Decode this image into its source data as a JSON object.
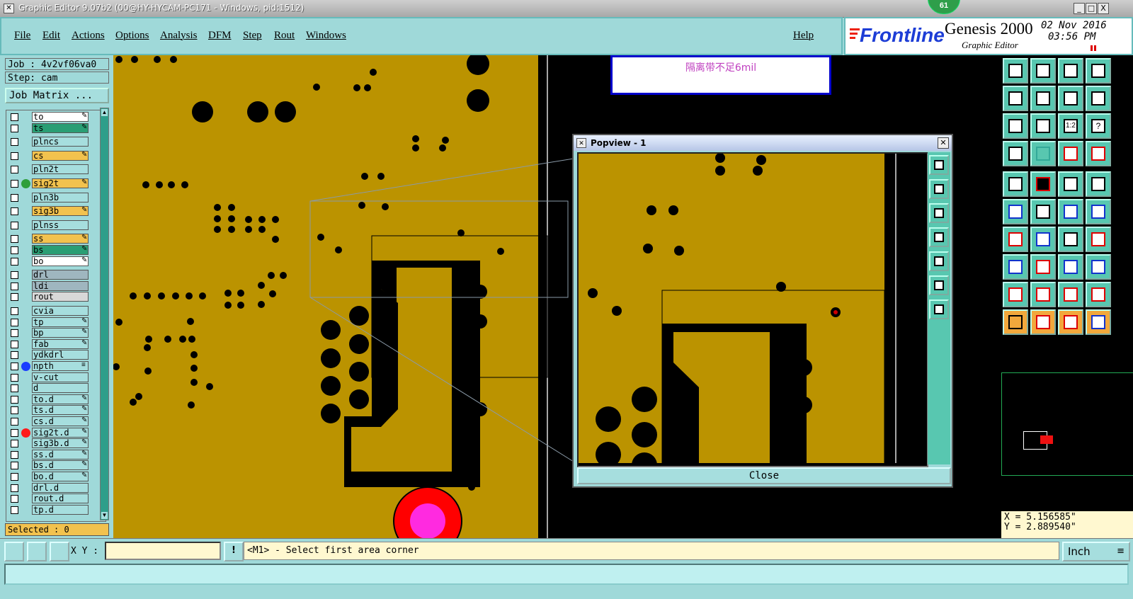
{
  "window": {
    "title": "Graphic Editor 9.07b2 (00@HY-HYCAM-PC171 - Windows, pid:1512)",
    "badge": "61",
    "minimize": "_",
    "maximize": "□",
    "close": "X"
  },
  "menu": {
    "items": [
      "File",
      "Edit",
      "Actions",
      "Options",
      "Analysis",
      "DFM",
      "Step",
      "Rout",
      "Windows"
    ],
    "help": "Help"
  },
  "brand": {
    "logo": "Frontline",
    "product": "Genesis 2000",
    "subtitle": "Graphic Editor",
    "date": "02 Nov 2016",
    "time": "03:56 PM"
  },
  "job": {
    "job_label": "Job : 4v2vf06va0",
    "step_label": "Step: cam",
    "matrix_button": "Job Matrix ..."
  },
  "layers": [
    {
      "name": "to",
      "color": "#ffffff",
      "mark": "✎"
    },
    {
      "name": "ts",
      "color": "#2a9e74",
      "mark": "✎"
    },
    {
      "name": "plncs",
      "color": "#a6dede",
      "mark": ""
    },
    {
      "name": "cs",
      "color": "#f2c24e",
      "mark": "✎"
    },
    {
      "name": "pln2t",
      "color": "#a6dede",
      "mark": ""
    },
    {
      "name": "sig2t",
      "color": "#f2c24e",
      "mark": "✎",
      "dot": "#2e9e3a"
    },
    {
      "name": "pln3b",
      "color": "#a6dede",
      "mark": ""
    },
    {
      "name": "sig3b",
      "color": "#f2c24e",
      "mark": "✎"
    },
    {
      "name": "plnss",
      "color": "#a6dede",
      "mark": ""
    },
    {
      "name": "ss",
      "color": "#f2c24e",
      "mark": "✎"
    },
    {
      "name": "bs",
      "color": "#2a9e74",
      "mark": "✎"
    },
    {
      "name": "bo",
      "color": "#ffffff",
      "mark": "✎"
    },
    {
      "name": "drl",
      "color": "#9fb6bf",
      "mark": ""
    },
    {
      "name": "ldi",
      "color": "#9fb6bf",
      "mark": ""
    },
    {
      "name": "rout",
      "color": "#d8d8d8",
      "mark": ""
    },
    {
      "name": "cvia",
      "color": "#a6dede",
      "mark": ""
    },
    {
      "name": "tp",
      "color": "#a6dede",
      "mark": "✎"
    },
    {
      "name": "bp",
      "color": "#a6dede",
      "mark": "✎"
    },
    {
      "name": "fab",
      "color": "#a6dede",
      "mark": "✎"
    },
    {
      "name": "ydkdrl",
      "color": "#a6dede",
      "mark": ""
    },
    {
      "name": "npth",
      "color": "#a6dede",
      "mark": "≡",
      "dot": "#1a3cff"
    },
    {
      "name": "v-cut",
      "color": "#a6dede",
      "mark": ""
    },
    {
      "name": "d",
      "color": "#a6dede",
      "mark": ""
    },
    {
      "name": "to.d",
      "color": "#a6dede",
      "mark": "✎"
    },
    {
      "name": "ts.d",
      "color": "#a6dede",
      "mark": "✎"
    },
    {
      "name": "cs.d",
      "color": "#a6dede",
      "mark": "✎"
    },
    {
      "name": "sig2t.d",
      "color": "#a6dede",
      "mark": "✎",
      "dot": "#ff1a1a"
    },
    {
      "name": "sig3b.d",
      "color": "#a6dede",
      "mark": "✎"
    },
    {
      "name": "ss.d",
      "color": "#a6dede",
      "mark": "✎"
    },
    {
      "name": "bs.d",
      "color": "#a6dede",
      "mark": "✎"
    },
    {
      "name": "bo.d",
      "color": "#a6dede",
      "mark": "✎"
    },
    {
      "name": "drl.d",
      "color": "#a6dede",
      "mark": ""
    },
    {
      "name": "rout.d",
      "color": "#a6dede",
      "mark": ""
    },
    {
      "name": "tp.d",
      "color": "#a6dede",
      "mark": ""
    }
  ],
  "selected_label": "Selected : 0",
  "note_popup": {
    "text": "隔离带不足6mil"
  },
  "popview": {
    "title": "Popview - 1",
    "close_button": "Close"
  },
  "coordinates": {
    "x": "X = 5.156585\"",
    "y": "Y = 2.889540\""
  },
  "bottom": {
    "xy_label": "X Y :",
    "xy_value": "",
    "warn_icon": "!",
    "message": "<M1> - Select first area corner",
    "units": "Inch",
    "units_arrow": "≡"
  },
  "colors": {
    "copper": "#bb9300",
    "board_bg": "#000000",
    "panel": "#9fd9d9",
    "accent_teal": "#58c7b0",
    "pad_red": "#ff0000",
    "pad_magenta": "#ff2ae0"
  }
}
